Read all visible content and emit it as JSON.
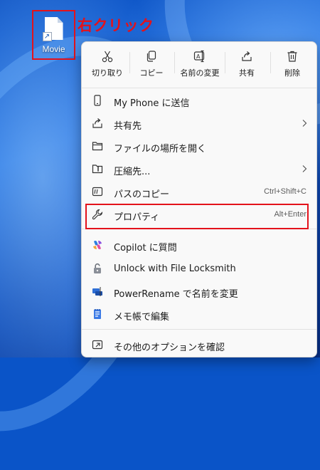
{
  "desktop": {
    "icon_label": "Movie",
    "callout_text": "右クリック"
  },
  "colors": {
    "annotation_red": "#e3121b",
    "menu_bg": "#f9f9f9",
    "text": "#1b1b1b",
    "accelerator_text": "#5c5c5c"
  },
  "menu": {
    "toolbar": [
      {
        "label": "切り取り",
        "icon": "scissors-icon"
      },
      {
        "label": "コピー",
        "icon": "copy-icon"
      },
      {
        "label": "名前の変更",
        "icon": "rename-icon"
      },
      {
        "label": "共有",
        "icon": "share-icon"
      },
      {
        "label": "削除",
        "icon": "trash-icon"
      }
    ],
    "items": [
      {
        "label": "My Phone に送信",
        "icon": "phone-icon"
      },
      {
        "label": "共有先",
        "icon": "share-icon",
        "submenu": true
      },
      {
        "label": "ファイルの場所を開く",
        "icon": "folder-icon"
      },
      {
        "label": "圧縮先...",
        "icon": "zip-folder-icon",
        "submenu": true
      },
      {
        "label": "パスのコピー",
        "icon": "copy-path-icon",
        "accelerator": "Ctrl+Shift+C"
      },
      {
        "label": "プロパティ",
        "icon": "wrench-icon",
        "accelerator": "Alt+Enter"
      },
      {
        "label": "Copilot に質問",
        "icon": "copilot-icon"
      },
      {
        "label": "Unlock with File Locksmith",
        "icon": "lock-icon"
      },
      {
        "label": "PowerRename で名前を変更",
        "icon": "power-rename-icon"
      },
      {
        "label": "メモ帳で編集",
        "icon": "notepad-icon"
      },
      {
        "label": "その他のオプションを確認",
        "icon": "more-options-icon"
      }
    ]
  }
}
